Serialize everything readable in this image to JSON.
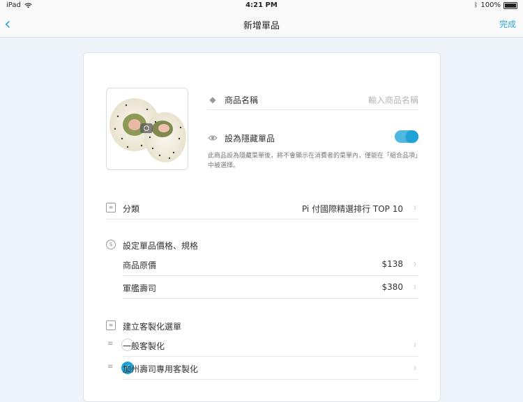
{
  "status_bar": {
    "device": "iPad",
    "time": "4:21 PM",
    "battery": "100%"
  },
  "nav": {
    "title": "新增單品",
    "done_label": "完成"
  },
  "item_name": {
    "label": "商品名稱",
    "placeholder": "輸入商品名稱"
  },
  "hidden_item": {
    "label": "設為隱藏單品",
    "enabled": true,
    "note": "此商品設為隱藏菜單後，將不會顯示在消費者的菜單內，僅能在「組合品項」中被選擇。"
  },
  "category": {
    "label": "分類",
    "value": "Pi 付國際精選排行 TOP 10"
  },
  "pricing": {
    "header": "設定單品價格、規格",
    "rows": [
      {
        "label": "商品原價",
        "price": "$138"
      },
      {
        "label": "軍艦壽司",
        "price": "$380"
      }
    ]
  },
  "customization": {
    "header": "建立客製化選單",
    "options": [
      {
        "label": "一般客製化",
        "checked": false
      },
      {
        "label": "加州壽司專用客製化",
        "checked": true
      }
    ]
  },
  "colors": {
    "accent": "#1ea3d8",
    "background": "#eef4f9"
  },
  "icons": [
    "wifi-icon",
    "bluetooth-icon",
    "battery-icon",
    "back-chevron-icon",
    "camera-icon",
    "tag-icon",
    "eye-icon",
    "list-icon",
    "dollar-icon",
    "menu-icon",
    "drag-handle-icon",
    "chevron-right-icon",
    "check-icon"
  ]
}
